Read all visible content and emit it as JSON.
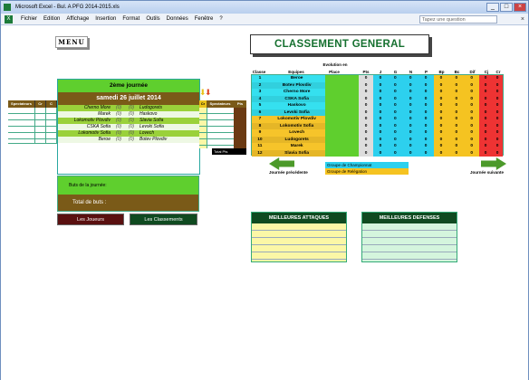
{
  "window": {
    "title": "Microsoft Excel - Bul. A PFG 2014-2015.xls"
  },
  "menu": {
    "items": [
      "Fichier",
      "Edition",
      "Affichage",
      "Insertion",
      "Format",
      "Outils",
      "Données",
      "Fenêtre",
      "?"
    ],
    "ask_placeholder": "Tapez une question",
    "close_glyph": "×"
  },
  "sheet": {
    "menu_button": "MENU",
    "title": "CLASSEMENT GENERAL",
    "journee": {
      "round": "2ème journée",
      "date": "samedi 26 juillet 2014",
      "matches": [
        {
          "home": "Cherno More",
          "sc1": "(0)",
          "sc2": "(0)",
          "away": "Ludogorets"
        },
        {
          "home": "Marek",
          "sc1": "(0)",
          "sc2": "(0)",
          "away": "Haskovo"
        },
        {
          "home": "Lokomotiv Plovdiv",
          "sc1": "(0)",
          "sc2": "(0)",
          "away": "Slavia Sofia"
        },
        {
          "home": "CSKA Sofia",
          "sc1": "(0)",
          "sc2": "(0)",
          "away": "Levski Sofia"
        },
        {
          "home": "Lokomotiv Sofia",
          "sc1": "(0)",
          "sc2": "(0)",
          "away": "Lovech"
        },
        {
          "home": "Beroe",
          "sc1": "(0)",
          "sc2": "(0)",
          "away": "Botev Plovdiv"
        }
      ]
    },
    "left_headers": [
      "Spectateurs",
      "Cr",
      "C"
    ],
    "right_headers": [
      "Cr",
      "Spectateurs",
      "Pts"
    ],
    "total_pts": "Total Pts",
    "buts_label": "Buts de la journée:",
    "total_buts": "Total de buts :",
    "btn_joueurs": "Les Joueurs",
    "btn_classements": "Les Classements",
    "standings_headers": {
      "classe": "Classe",
      "equipes": "Equipes",
      "evolution": "Evolution en",
      "place": "Place",
      "pts": "Pts",
      "j": "J",
      "g": "G",
      "n": "N",
      "p": "P",
      "bp": "Bp",
      "bc": "Bc",
      "dif": "Dif",
      "cj": "Cj",
      "cr": "Cr"
    },
    "standings": [
      {
        "rank": "1",
        "team": "Beroe",
        "pts": "0",
        "j": "0",
        "g": "0",
        "n": "0",
        "p": "0",
        "bp": "0",
        "bc": "0",
        "dif": "0",
        "cj": "0",
        "cr": "0"
      },
      {
        "rank": "2",
        "team": "Botev Plovdiv",
        "pts": "0",
        "j": "0",
        "g": "0",
        "n": "0",
        "p": "0",
        "bp": "0",
        "bc": "0",
        "dif": "0",
        "cj": "0",
        "cr": "0"
      },
      {
        "rank": "3",
        "team": "Cherno More",
        "pts": "0",
        "j": "0",
        "g": "0",
        "n": "0",
        "p": "0",
        "bp": "0",
        "bc": "0",
        "dif": "0",
        "cj": "0",
        "cr": "0"
      },
      {
        "rank": "4",
        "team": "CSKA Sofia",
        "pts": "0",
        "j": "0",
        "g": "0",
        "n": "0",
        "p": "0",
        "bp": "0",
        "bc": "0",
        "dif": "0",
        "cj": "0",
        "cr": "0"
      },
      {
        "rank": "5",
        "team": "Haskovo",
        "pts": "0",
        "j": "0",
        "g": "0",
        "n": "0",
        "p": "0",
        "bp": "0",
        "bc": "0",
        "dif": "0",
        "cj": "0",
        "cr": "0"
      },
      {
        "rank": "6",
        "team": "Levski Sofia",
        "pts": "0",
        "j": "0",
        "g": "0",
        "n": "0",
        "p": "0",
        "bp": "0",
        "bc": "0",
        "dif": "0",
        "cj": "0",
        "cr": "0"
      },
      {
        "rank": "7",
        "team": "Lokomotiv Plovdiv",
        "pts": "0",
        "j": "0",
        "g": "0",
        "n": "0",
        "p": "0",
        "bp": "0",
        "bc": "0",
        "dif": "0",
        "cj": "0",
        "cr": "0"
      },
      {
        "rank": "8",
        "team": "Lokomotiv Sofia",
        "pts": "0",
        "j": "0",
        "g": "0",
        "n": "0",
        "p": "0",
        "bp": "0",
        "bc": "0",
        "dif": "0",
        "cj": "0",
        "cr": "0"
      },
      {
        "rank": "9",
        "team": "Lovech",
        "pts": "0",
        "j": "0",
        "g": "0",
        "n": "0",
        "p": "0",
        "bp": "0",
        "bc": "0",
        "dif": "0",
        "cj": "0",
        "cr": "0"
      },
      {
        "rank": "10",
        "team": "Ludogorets",
        "pts": "0",
        "j": "0",
        "g": "0",
        "n": "0",
        "p": "0",
        "bp": "0",
        "bc": "0",
        "dif": "0",
        "cj": "0",
        "cr": "0"
      },
      {
        "rank": "11",
        "team": "Marek",
        "pts": "0",
        "j": "0",
        "g": "0",
        "n": "0",
        "p": "0",
        "bp": "0",
        "bc": "0",
        "dif": "0",
        "cj": "0",
        "cr": "0"
      },
      {
        "rank": "12",
        "team": "Slavia Sofia",
        "pts": "0",
        "j": "0",
        "g": "0",
        "n": "0",
        "p": "0",
        "bp": "0",
        "bc": "0",
        "dif": "0",
        "cj": "0",
        "cr": "0"
      }
    ],
    "legend": {
      "championnat": "Groupe de Championnat",
      "relegation": "Groupe de Relégation"
    },
    "journee_precedente": "Journée précédente",
    "journee_suivante": "Journée suivante",
    "meilleures_attaques": "MEILLEURES ATTAQUES",
    "meilleures_defenses": "MEILLEURES DEFENSES"
  },
  "colors": {
    "green": "#5fcf2e",
    "brown": "#7a5a18",
    "cyan": "#2dd0ee",
    "orange": "#f5c321",
    "red": "#e33",
    "dark_green": "#0f4a20",
    "dark_red": "#5a1010"
  }
}
